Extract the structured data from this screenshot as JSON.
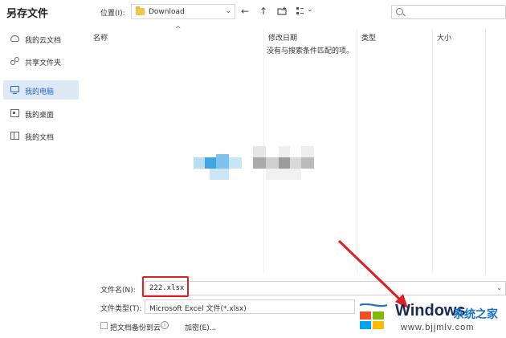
{
  "dialog": {
    "title": "另存文件"
  },
  "toolbar": {
    "location_label": "位置(I):",
    "location_value": "Download",
    "back_glyph": "←",
    "up_glyph": "↑",
    "dropdown_glyph": "⌄"
  },
  "sidebar": {
    "items": [
      {
        "label": "我的云文档",
        "icon": "cloud-icon"
      },
      {
        "label": "共享文件夹",
        "icon": "share-icon"
      },
      {
        "label": "我的电脑",
        "icon": "computer-icon",
        "active": true
      },
      {
        "label": "我的桌面",
        "icon": "desktop-icon"
      },
      {
        "label": "我的文档",
        "icon": "document-icon"
      }
    ]
  },
  "file_list": {
    "columns": [
      "名称",
      "修改日期",
      "类型",
      "大小"
    ],
    "sort_glyph": "^",
    "empty_message": "没有与搜索条件匹配的项。"
  },
  "bottom": {
    "filename_label": "文件名(N):",
    "filename_value": "222.xlsx",
    "filetype_label": "文件类型(T):",
    "filetype_value": "Microsoft Excel 文件(*.xlsx)",
    "backup_label": "把文档备份到云",
    "encrypt_label": "加密(E)...",
    "info_glyph": "i",
    "expand_glyph": "⌄"
  },
  "watermark": {
    "brand": "Windows",
    "site_name": "系统之家",
    "url": "www.bjjmlv.com"
  },
  "colors": {
    "accent": "#2466c6",
    "highlight_box": "#e02020",
    "arrow": "#e02020",
    "active_bg": "#dde8f5"
  }
}
